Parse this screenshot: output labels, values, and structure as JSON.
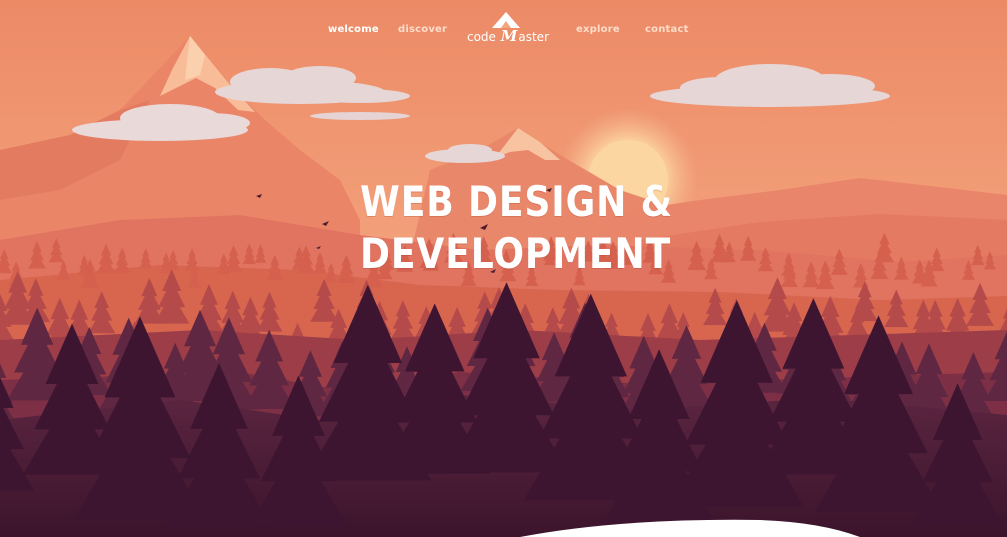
{
  "nav": {
    "items": [
      {
        "label": "welcome",
        "active": true
      },
      {
        "label": "discover",
        "active": false
      },
      {
        "label": "explore",
        "active": false
      },
      {
        "label": "contact",
        "active": false
      }
    ]
  },
  "logo": {
    "text_before": "code",
    "text_mark": "M",
    "text_after": "aster"
  },
  "hero": {
    "line1": "WEB DESIGN &",
    "line2": "DEVELOPMENT"
  },
  "colors": {
    "sky_top": "#ee8f6a",
    "sky_bottom": "#f7b48a",
    "sun": "#fbd7a1",
    "mountain_far": "#e9876a",
    "mountain_snow": "#f9c4a0",
    "hill_mid": "#e5775f",
    "trees_light": "#d8634f",
    "trees_mid": "#b34b4a",
    "trees_dark": "#5a2440",
    "ground_dark": "#3f1730",
    "cloud": "#e8dada"
  }
}
